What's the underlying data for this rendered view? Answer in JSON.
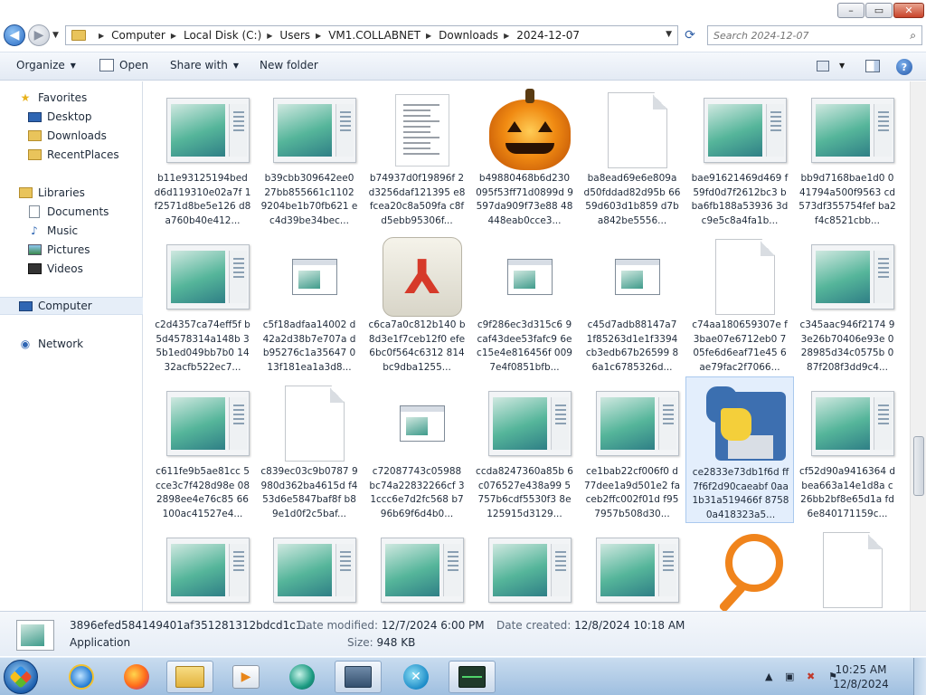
{
  "window": {
    "min_label": "–",
    "max_label": "▭",
    "close_label": "✕"
  },
  "address": {
    "crumbs": [
      "Computer",
      "Local Disk (C:)",
      "Users",
      "VM1.COLLABNET",
      "Downloads",
      "2024-12-07"
    ]
  },
  "search": {
    "placeholder": "Search 2024-12-07"
  },
  "toolbar": {
    "organize": "Organize",
    "open": "Open",
    "share_with": "Share with",
    "new_folder": "New folder"
  },
  "nav": {
    "favorites": "Favorites",
    "desktop": "Desktop",
    "downloads": "Downloads",
    "recent_places": "RecentPlaces",
    "libraries": "Libraries",
    "documents": "Documents",
    "music": "Music",
    "pictures": "Pictures",
    "videos": "Videos",
    "computer": "Computer",
    "network": "Network"
  },
  "files": [
    {
      "name": "b11e93125194bed d6d119310e02a7f 1f2571d8be5e126 d8a760b40e412...",
      "icon": "screenshot"
    },
    {
      "name": "b39cbb309642ee0 27bb855661c1102 9204be1b70fb621 ec4d39be34bec...",
      "icon": "screenshot"
    },
    {
      "name": "b74937d0f19896f 2d3256daf121395 e8fcea20c8a509fa c8fd5ebb95306f...",
      "icon": "paper"
    },
    {
      "name": "b49880468b6d230 095f53ff71d0899d 9597da909f73e88 48448eab0cce3...",
      "icon": "pumpkin"
    },
    {
      "name": "ba8ead69e6e809a d50fddad82d95b 6659d603d1b859 d7ba842be5556...",
      "icon": "blank"
    },
    {
      "name": "bae91621469d469 f59fd0d7f2612bc3 bba6fb188a53936 3dc9e5c8a4fa1b...",
      "icon": "screenshot"
    },
    {
      "name": "bb9d7168bae1d0 041794a500f9563 cd573df355754fef ba2f4c8521cbb...",
      "icon": "screenshot"
    },
    {
      "name": "c2d4357ca74eff5f b5d4578314a148b 35b1ed049bb7b0 1432acfb522ec7...",
      "icon": "screenshot"
    },
    {
      "name": "c5f18adfaa14002 d42a2d38b7e707a db95276c1a35647 013f181ea1a3d8...",
      "icon": "window"
    },
    {
      "name": "c6ca7a0c812b140 b8d3e1f7ceb12f0 efe6bc0f564c6312 814bc9dba1255...",
      "icon": "pdf"
    },
    {
      "name": "c9f286ec3d315c6 9caf43dee53fafc9 6ec15e4e816456f 0097e4f0851bfb...",
      "icon": "window"
    },
    {
      "name": "c45d7adb88147a7 1f85263d1e1f3394 cb3edb67b26599 86a1c6785326d...",
      "icon": "window"
    },
    {
      "name": "c74aa180659307e f3bae07e6712eb0 705fe6d6eaf71e45 6ae79fac2f7066...",
      "icon": "blank"
    },
    {
      "name": "c345aac946f2174 93e26b70406e93e 028985d34c0575b 087f208f3dd9c4...",
      "icon": "screenshot"
    },
    {
      "name": "c611fe9b5ae81cc 5cce3c7f428d98e 082898ee4e76c85 66100ac41527e4...",
      "icon": "screenshot"
    },
    {
      "name": "c839ec03c9b0787 9980d362ba4615d f453d6e5847baf8f b89e1d0f2c5baf...",
      "icon": "blank"
    },
    {
      "name": "c72087743c05988 bc74a22832266cf 31ccc6e7d2fc568 b796b69f6d4b0...",
      "icon": "window"
    },
    {
      "name": "ccda8247360a85b 6c076527e438a99 5757b6cdf5530f3 8e125915d3129...",
      "icon": "screenshot"
    },
    {
      "name": "ce1bab22cf006f0 d77dee1a9d501e2 faceb2ffc002f01d f957957b508d30...",
      "icon": "screenshot"
    },
    {
      "name": "ce2833e73db1f6d ff7f6f2d90caeabf 0aa1b31a519466f 87580a418323a5...",
      "icon": "python"
    },
    {
      "name": "cf52d90a9416364 dbea663a14e1d8a c26bb2bf8e65d1a fd6e840171159c...",
      "icon": "screenshot"
    },
    {
      "name": "",
      "icon": "screenshot"
    },
    {
      "name": "",
      "icon": "screenshot"
    },
    {
      "name": "",
      "icon": "screenshot"
    },
    {
      "name": "",
      "icon": "screenshot"
    },
    {
      "name": "",
      "icon": "screenshot"
    },
    {
      "name": "",
      "icon": "magnifier"
    },
    {
      "name": "",
      "icon": "blank"
    }
  ],
  "details": {
    "filename": "3896efed584149401af351281312bdcd1c1...",
    "type": "Application",
    "date_modified_label": "Date modified:",
    "date_modified": "12/7/2024 6:00 PM",
    "size_label": "Size:",
    "size": "948 KB",
    "date_created_label": "Date created:",
    "date_created": "12/8/2024 10:18 AM"
  },
  "taskbar": {
    "apps": [
      "internet-explorer",
      "firefox",
      "file-explorer",
      "media-player",
      "app-green",
      "remote-desktop",
      "accessibility",
      "task-manager"
    ]
  },
  "clock": {
    "time": "10:25 AM",
    "date": "12/8/2024"
  },
  "colors": {
    "selection": "#e3eefc",
    "accent": "#2a6cc4",
    "cmdbar": "#e3eaf4"
  }
}
